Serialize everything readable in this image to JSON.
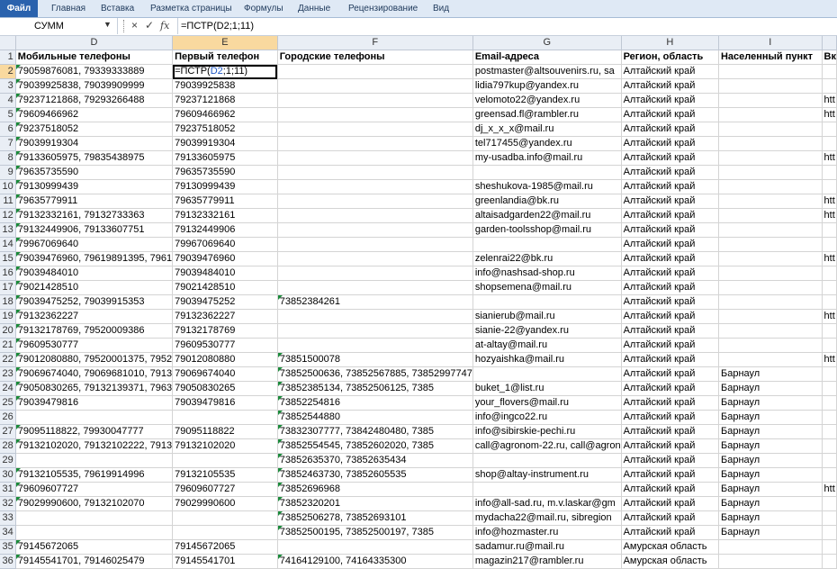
{
  "ribbon": {
    "tabs": [
      "Файл",
      "Главная",
      "Вставка",
      "Разметка страницы",
      "Формулы",
      "Данные",
      "Рецензирование",
      "Вид"
    ]
  },
  "formula_bar": {
    "name_box": "СУММ",
    "cancel_glyph": "×",
    "enter_glyph": "✓",
    "fx_label": "fx",
    "formula": "=ПСТР(D2;1;11)"
  },
  "grid": {
    "columns": [
      "D",
      "E",
      "F",
      "G",
      "H",
      "I",
      ""
    ],
    "headers": [
      "Мобильные телефоны",
      "Первый телефон",
      "Городские телефоны",
      "Email-адреса",
      "Регион, область",
      "Населенный пункт",
      "Вк"
    ],
    "active_cell_formula": {
      "prefix": "=ПСТР(",
      "ref": "D2",
      "suffix": ";1;11)"
    },
    "rows": [
      [
        "79059876081, 79339333889",
        "",
        "",
        "postmaster@altsouvenirs.ru, sa",
        "Алтайский край",
        "",
        ""
      ],
      [
        "79039925838, 79039909999",
        "79039925838",
        "",
        "lidia797kup@yandex.ru",
        "Алтайский край",
        "",
        ""
      ],
      [
        "79237121868, 79293266488",
        "79237121868",
        "",
        "velomoto22@yandex.ru",
        "Алтайский край",
        "",
        "htt"
      ],
      [
        "79609466962",
        "79609466962",
        "",
        "greensad.fl@rambler.ru",
        "Алтайский край",
        "",
        "htt"
      ],
      [
        "79237518052",
        "79237518052",
        "",
        "dj_x_x_x@mail.ru",
        "Алтайский край",
        "",
        ""
      ],
      [
        "79039919304",
        "79039919304",
        "",
        "tel717455@yandex.ru",
        "Алтайский край",
        "",
        ""
      ],
      [
        "79133605975, 79835438975",
        "79133605975",
        "",
        "my-usadba.info@mail.ru",
        "Алтайский край",
        "",
        "htt"
      ],
      [
        "79635735590",
        "79635735590",
        "",
        "",
        "Алтайский край",
        "",
        ""
      ],
      [
        "79130999439",
        "79130999439",
        "",
        "sheshukova-1985@mail.ru",
        "Алтайский край",
        "",
        ""
      ],
      [
        "79635779911",
        "79635779911",
        "",
        "greenlandia@bk.ru",
        "Алтайский край",
        "",
        "htt"
      ],
      [
        "79132332161, 79132733363",
        "79132332161",
        "",
        "altaisadgarden22@mail.ru",
        "Алтайский край",
        "",
        "htt"
      ],
      [
        "79132449906, 79133607751",
        "79132449906",
        "",
        "garden-toolsshop@mail.ru",
        "Алтайский край",
        "",
        ""
      ],
      [
        "79967069640",
        "79967069640",
        "",
        "",
        "Алтайский край",
        "",
        ""
      ],
      [
        "79039476960, 79619891395, 7961",
        "79039476960",
        "",
        "zelenrai22@bk.ru",
        "Алтайский край",
        "",
        "htt"
      ],
      [
        "79039484010",
        "79039484010",
        "",
        "info@nashsad-shop.ru",
        "Алтайский край",
        "",
        ""
      ],
      [
        "79021428510",
        "79021428510",
        "",
        "shopsemena@mail.ru",
        "Алтайский край",
        "",
        ""
      ],
      [
        "79039475252, 79039915353",
        "79039475252",
        "73852384261",
        "",
        "Алтайский край",
        "",
        ""
      ],
      [
        "79132362227",
        "79132362227",
        "",
        "sianierub@mail.ru",
        "Алтайский край",
        "",
        "htt"
      ],
      [
        "79132178769, 79520009386",
        "79132178769",
        "",
        "sianie-22@yandex.ru",
        "Алтайский край",
        "",
        ""
      ],
      [
        "79609530777",
        "79609530777",
        "",
        "at-altay@mail.ru",
        "Алтайский край",
        "",
        ""
      ],
      [
        "79012080880, 79520001375, 7952",
        "79012080880",
        "73851500078",
        "hozyaishka@mail.ru",
        "Алтайский край",
        "",
        "htt"
      ],
      [
        "79069674040, 79069681010, 7913",
        "79069674040",
        "73852500636, 73852567885, 73852997747",
        "",
        "Алтайский край",
        "Барнаул",
        ""
      ],
      [
        "79050830265, 79132139371, 7963",
        "79050830265",
        "73852385134, 73852506125, 7385",
        "buket_1@list.ru",
        "Алтайский край",
        "Барнаул",
        ""
      ],
      [
        "79039479816",
        "79039479816",
        "73852254816",
        "your_flovers@mail.ru",
        "Алтайский край",
        "Барнаул",
        ""
      ],
      [
        "",
        "",
        "73852544880",
        "info@ingco22.ru",
        "Алтайский край",
        "Барнаул",
        ""
      ],
      [
        "79095118822, 79930047777",
        "79095118822",
        "73832307777, 73842480480, 7385",
        "info@sibirskie-pechi.ru",
        "Алтайский край",
        "Барнаул",
        ""
      ],
      [
        "79132102020, 79132102222, 7913",
        "79132102020",
        "73852554545, 73852602020, 7385",
        "call@agronom-22.ru, call@agron",
        "Алтайский край",
        "Барнаул",
        ""
      ],
      [
        "",
        "",
        "73852635370, 73852635434",
        "",
        "Алтайский край",
        "Барнаул",
        ""
      ],
      [
        "79132105535, 79619914996",
        "79132105535",
        "73852463730, 73852605535",
        "shop@altay-instrument.ru",
        "Алтайский край",
        "Барнаул",
        ""
      ],
      [
        "79609607727",
        "79609607727",
        "73852696968",
        "",
        "Алтайский край",
        "Барнаул",
        "htt"
      ],
      [
        "79029990600, 79132102070",
        "79029990600",
        "73852320201",
        "info@all-sad.ru, m.v.laskar@gm",
        "Алтайский край",
        "Барнаул",
        ""
      ],
      [
        "",
        "",
        "73852506278, 73852693101",
        "mydacha22@mail.ru, sibregion",
        "Алтайский край",
        "Барнаул",
        ""
      ],
      [
        "",
        "",
        "73852500195, 73852500197, 7385",
        "info@hozmaster.ru",
        "Алтайский край",
        "Барнаул",
        ""
      ],
      [
        "79145672065",
        "79145672065",
        "",
        "sadamur.ru@mail.ru",
        "Амурская область",
        "",
        ""
      ],
      [
        "79145541701, 79146025479",
        "79145541701",
        "74164129100, 74164335300",
        "magazin217@rambler.ru",
        "Амурская область",
        "",
        ""
      ]
    ]
  }
}
